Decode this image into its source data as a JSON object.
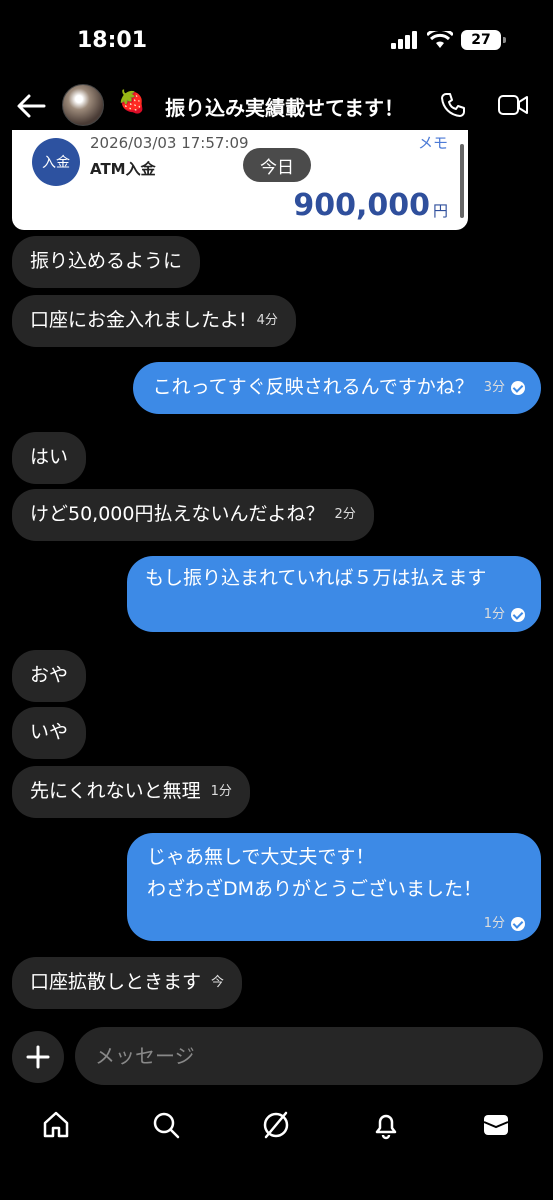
{
  "status_bar": {
    "time": "18:01",
    "battery": "27"
  },
  "header": {
    "avatar_label": "avatar",
    "emoji": "🍓",
    "title": "振り込み実績載せてます！"
  },
  "card": {
    "icon_text": "入金",
    "date": "2026/03/03 17:57:09",
    "memo": "メモ",
    "type": "ATM入金",
    "amount": "900,000",
    "yen": "円"
  },
  "today_label": "今日",
  "messages": [
    {
      "side": "in",
      "text": "振り込めるように",
      "time": ""
    },
    {
      "side": "in",
      "text": "口座にお金入れましたよ!",
      "time": "4分"
    },
    {
      "side": "out",
      "text": "これってすぐ反映されるんですかね？",
      "time": "3分"
    },
    {
      "side": "in",
      "text": "はい",
      "time": ""
    },
    {
      "side": "in",
      "text": "けど50,000円払えないんだよね？",
      "time": "2分"
    },
    {
      "side": "out",
      "text": "もし振り込まれていれば５万は払えます",
      "time": "1分"
    },
    {
      "side": "in",
      "text": "おや",
      "time": ""
    },
    {
      "side": "in",
      "text": "いや",
      "time": ""
    },
    {
      "side": "in",
      "text": "先にくれないと無理",
      "time": "1分"
    },
    {
      "side": "out",
      "line1": "じゃあ無しで大丈夫です！",
      "line2": "わざわざDMありがとうございました！",
      "time": "1分"
    },
    {
      "side": "in",
      "text": "口座拡散しときます",
      "time": "今"
    }
  ],
  "composer": {
    "placeholder": "メッセージ"
  },
  "colors": {
    "outgoing": "#3d8ae6",
    "incoming": "#262626",
    "card_blue": "#2f4f9c"
  },
  "icons": [
    "back-arrow-icon",
    "phone-icon",
    "video-icon",
    "plus-icon",
    "home-icon",
    "search-icon",
    "compass-icon",
    "bell-icon",
    "mail-icon"
  ]
}
